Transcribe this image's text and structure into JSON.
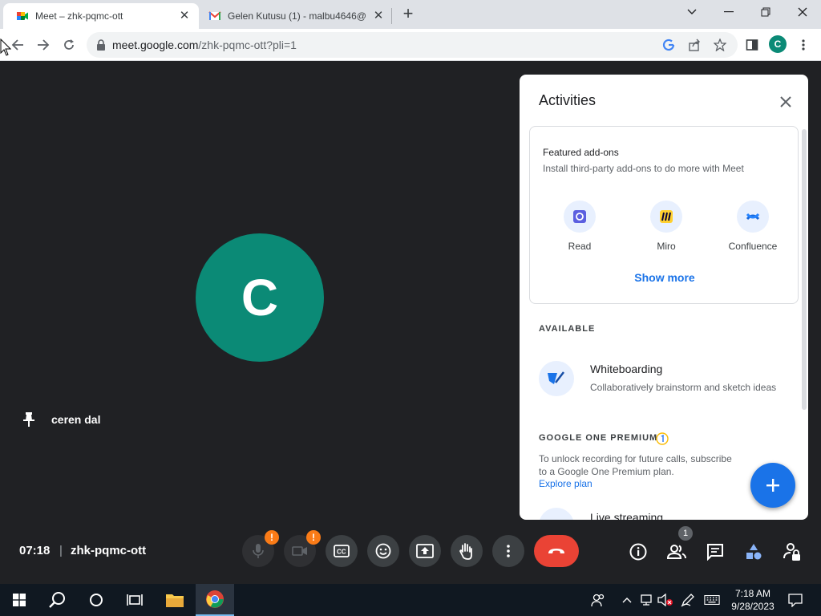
{
  "browser": {
    "tabs": [
      {
        "title": "Meet – zhk-pqmc-ott",
        "icon": "google-meet-icon",
        "active": true
      },
      {
        "title": "Gelen Kutusu (1) - malbu4646@",
        "icon": "gmail-icon",
        "active": false
      }
    ],
    "url_host": "meet.google.com",
    "url_path": "/zhk-pqmc-ott?pli=1",
    "profile_initial": "C"
  },
  "meeting": {
    "participant_initial": "C",
    "participant_name": "ceren dal",
    "time": "07:18",
    "separator": "|",
    "code": "zhk-pqmc-ott",
    "people_count": "1",
    "mic_warning": "!",
    "cam_warning": "!"
  },
  "activities": {
    "title": "Activities",
    "featured_heading": "Featured add-ons",
    "featured_sub": "Install third-party add-ons to do more with Meet",
    "addons": [
      {
        "label": "Read",
        "icon": "read-icon"
      },
      {
        "label": "Miro",
        "icon": "miro-icon"
      },
      {
        "label": "Confluence",
        "icon": "confluence-icon"
      }
    ],
    "show_more": "Show more",
    "available_label": "AVAILABLE",
    "whiteboard_title": "Whiteboarding",
    "whiteboard_sub": "Collaboratively brainstorm and sketch ideas",
    "premium_label": "GOOGLE ONE PREMIUM",
    "premium_text": "To unlock recording for future calls, subscribe to a Google One Premium plan.",
    "explore_plan": "Explore plan",
    "live_title": "Live streaming"
  },
  "taskbar": {
    "time": "7:18 AM",
    "date": "9/28/2023"
  },
  "colors": {
    "meet_bg": "#202124",
    "avatar": "#0b8a76",
    "accent": "#1a73e8",
    "end_call": "#ea4335",
    "warning": "#fa7b17"
  }
}
